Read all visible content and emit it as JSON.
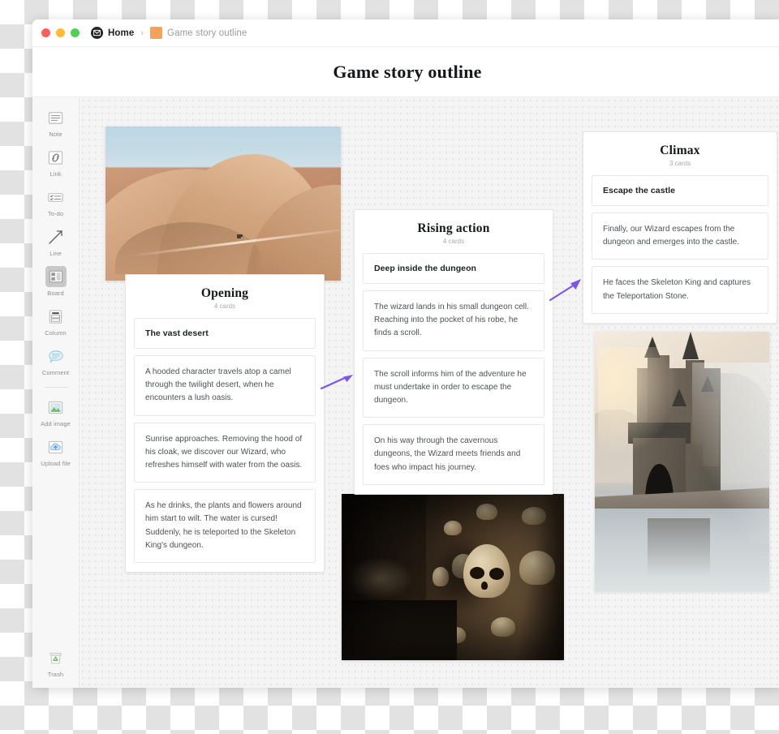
{
  "window": {
    "traffic_lights": [
      "close",
      "minimize",
      "maximize"
    ],
    "breadcrumb": {
      "home_label": "Home",
      "separator": "›",
      "current_label": "Game story outline",
      "current_swatch_color": "#f5a25d"
    }
  },
  "header": {
    "title": "Game story outline"
  },
  "sidebar": {
    "items": [
      {
        "label": "Note",
        "icon": "note-icon",
        "selected": false
      },
      {
        "label": "Link",
        "icon": "link-icon",
        "selected": false
      },
      {
        "label": "To-do",
        "icon": "todo-icon",
        "selected": false
      },
      {
        "label": "Line",
        "icon": "line-icon",
        "selected": false
      },
      {
        "label": "Board",
        "icon": "board-icon",
        "selected": true
      },
      {
        "label": "Column",
        "icon": "column-icon",
        "selected": false
      },
      {
        "label": "Comment",
        "icon": "comment-icon",
        "selected": false
      },
      {
        "label": "Add image",
        "icon": "add-image-icon",
        "selected": false
      },
      {
        "label": "Upload file",
        "icon": "upload-file-icon",
        "selected": false
      }
    ],
    "trash": {
      "label": "Trash",
      "icon": "trash-icon"
    }
  },
  "canvas": {
    "accent_color": "#7b57e8",
    "columns": [
      {
        "title": "Opening",
        "count_label": "4 cards",
        "cards": [
          {
            "type": "heading",
            "text": "The vast desert"
          },
          {
            "type": "body",
            "text": "A hooded character travels atop a camel through the twilight desert, when he encounters a lush oasis."
          },
          {
            "type": "body",
            "text": "Sunrise approaches. Removing the hood of his cloak, we discover our Wizard, who refreshes himself with water from the oasis."
          },
          {
            "type": "body",
            "text": "As he drinks, the plants and flowers around him start to wilt. The water is cursed! Suddenly, he is teleported to the Skeleton King's dungeon."
          }
        ]
      },
      {
        "title": "Rising action",
        "count_label": "4 cards",
        "cards": [
          {
            "type": "heading",
            "text": "Deep inside the dungeon"
          },
          {
            "type": "body",
            "text": "The wizard lands in his small dungeon cell. Reaching into the pocket of his robe, he finds a scroll."
          },
          {
            "type": "body",
            "text": "The scroll informs him of the adventure he must undertake in order to escape the dungeon."
          },
          {
            "type": "body",
            "text": "On his way through the cavernous dungeons, the Wizard meets friends and foes who impact his journey."
          }
        ]
      },
      {
        "title": "Climax",
        "count_label": "3 cards",
        "cards": [
          {
            "type": "heading",
            "text": "Escape the castle"
          },
          {
            "type": "body",
            "text": "Finally, our Wizard escapes from the dungeon and emerges into the castle."
          },
          {
            "type": "body",
            "text": "He faces the Skeleton King and captures the Teleportation Stone."
          }
        ]
      }
    ],
    "images": [
      {
        "name": "desert-dunes-photo",
        "alt": "Sand dunes under a pale blue sky"
      },
      {
        "name": "catacombs-skulls-photo",
        "alt": "Dark catacomb wall lined with skulls"
      },
      {
        "name": "misty-castle-photo",
        "alt": "Misty castle reflected in still water"
      }
    ],
    "connectors": [
      {
        "name": "arrow-opening-to-rising",
        "direction": "right"
      },
      {
        "name": "arrow-rising-to-climax",
        "direction": "up-right"
      }
    ]
  }
}
